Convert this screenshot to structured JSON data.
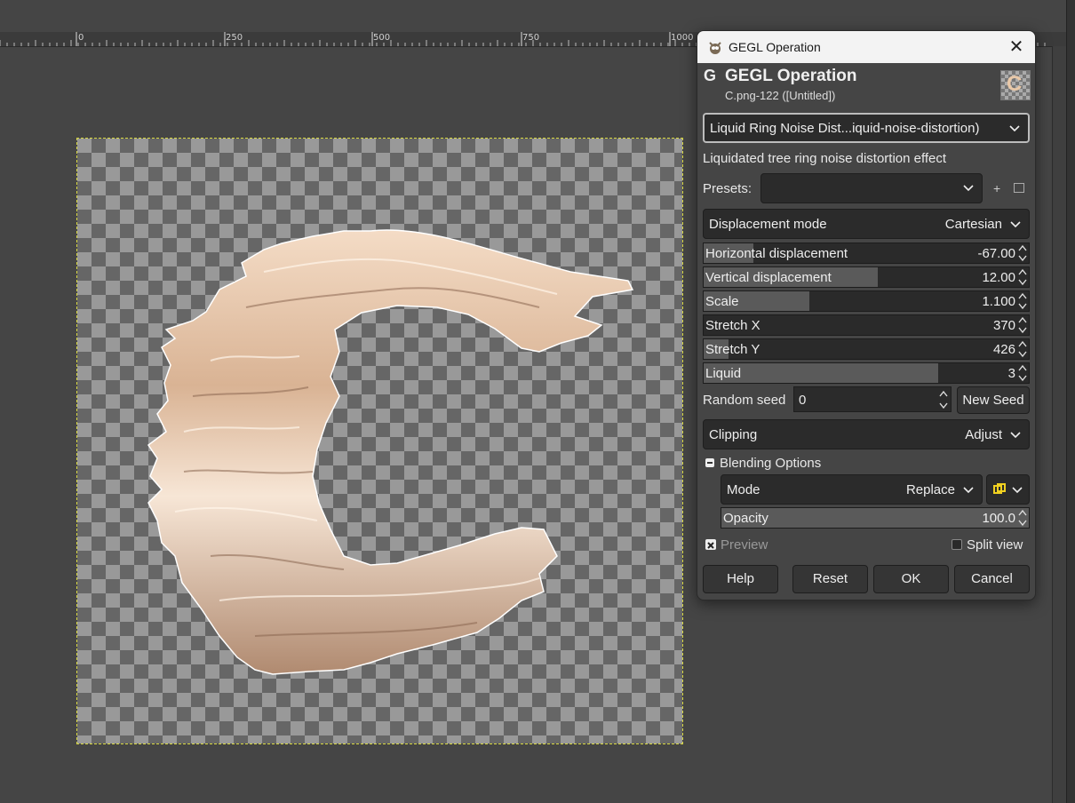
{
  "ruler": {
    "ticks": [
      "0",
      "250",
      "500",
      "750",
      "1000"
    ]
  },
  "dialog": {
    "window_title": "GEGL Operation",
    "close_glyph": "✕",
    "header_title": "GEGL Operation",
    "header_subtitle": "C.png-122 ([Untitled])",
    "operation": "Liquid Ring Noise Dist...iquid-noise-distortion)",
    "description": "Liquidated tree ring noise distortion effect",
    "presets_label": "Presets:",
    "presets_value": "",
    "displacement_mode": {
      "label": "Displacement mode",
      "value": "Cartesian"
    },
    "sliders": [
      {
        "label": "Horizontal displacement",
        "value": "-67.00",
        "fill": 0.154
      },
      {
        "label": "Vertical displacement",
        "value": "12.00",
        "fill": 0.535
      },
      {
        "label": "Scale",
        "value": "1.100",
        "fill": 0.326
      },
      {
        "label": "Stretch X",
        "value": "370",
        "fill": 0.0
      },
      {
        "label": "Stretch Y",
        "value": "426",
        "fill": 0.076
      },
      {
        "label": "Liquid",
        "value": "3",
        "fill": 0.72
      }
    ],
    "random_seed": {
      "label": "Random seed",
      "value": "0",
      "button": "New Seed"
    },
    "clipping": {
      "label": "Clipping",
      "value": "Adjust"
    },
    "blending": {
      "label": "Blending Options",
      "mode_label": "Mode",
      "mode_value": "Replace",
      "opacity_label": "Opacity",
      "opacity_value": "100.0",
      "opacity_fill": 1.0
    },
    "preview": {
      "label": "Preview",
      "checked": true
    },
    "split_view": {
      "label": "Split view",
      "checked": false
    },
    "buttons": {
      "help": "Help",
      "reset": "Reset",
      "ok": "OK",
      "cancel": "Cancel"
    }
  },
  "colors": {
    "canvas_bg": "#454545",
    "selection": "#d8d840",
    "letter": "#e6c3a6"
  }
}
